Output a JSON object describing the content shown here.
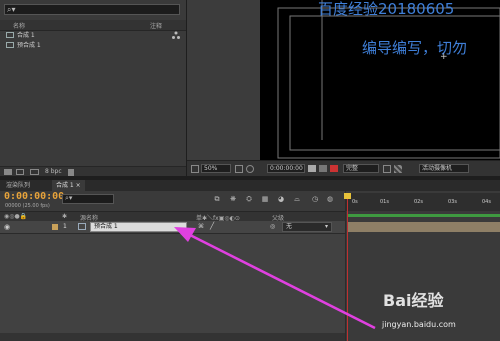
{
  "project_panel": {
    "search_icon": "⌕▾",
    "col_name": "名称",
    "col_comment": "注释",
    "items": [
      {
        "label": "合成 1",
        "icon": "composition-icon"
      },
      {
        "label": "预合成 1",
        "icon": "composition-icon"
      }
    ],
    "bpc": "8 bpc"
  },
  "viewer": {
    "overlay_title": "百度经验20180605",
    "overlay_sub": "编导编写，切勿",
    "zoom": "50%",
    "timecode": "0:00:00:00",
    "resolution": "完整",
    "camera": "活动摄像机"
  },
  "timeline": {
    "tabs": [
      "渲染队列",
      "合成 1"
    ],
    "tab_close": "×",
    "timecode": "0:00:00:00",
    "fps": "00000 (25.00 fps)",
    "search_icon": "⌕▾",
    "header": {
      "col_source": "源名称",
      "col_switches": "单✱＼fx▣◎◐⊙",
      "col_parent": "父级"
    },
    "layer": {
      "index": "1",
      "name": "预合成 1",
      "parent": "无"
    },
    "ruler_ticks": [
      "0s",
      "01s",
      "02s",
      "03s",
      "04s"
    ]
  },
  "watermark": {
    "brand": "Bai经验",
    "url": "jingyan.baidu.com"
  },
  "colors": {
    "timecode": "#e7a33a",
    "overlay_text": "#3f7fd8",
    "arrow": "#e040e0",
    "work_area": "#3e9a40",
    "layer_bar": "#8e7f66",
    "playhead": "#c03030"
  }
}
